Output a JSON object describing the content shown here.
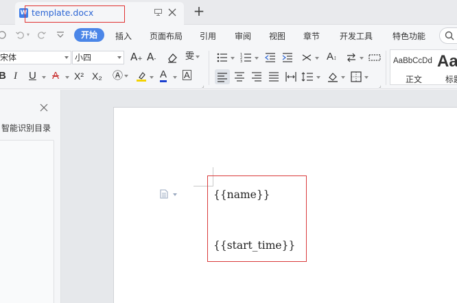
{
  "tab": {
    "title": "template.docx",
    "new_tab_symbol": "+"
  },
  "menu": {
    "items": [
      {
        "label": "开始",
        "active": true
      },
      {
        "label": "插入"
      },
      {
        "label": "页面布局"
      },
      {
        "label": "引用"
      },
      {
        "label": "审阅"
      },
      {
        "label": "视图"
      },
      {
        "label": "章节"
      },
      {
        "label": "开发工具"
      },
      {
        "label": "特色功能"
      }
    ]
  },
  "ribbon": {
    "font_name": "宋体",
    "font_size": "小四",
    "bold_label": "B",
    "italic_label": "I",
    "underline_label": "U",
    "strike_label": "A",
    "superscript_label": "X²",
    "subscript_label": "X₂",
    "font_color_label": "A",
    "styles": [
      {
        "sample": "AaBbCcDd",
        "label": "正文"
      },
      {
        "sample": "Aa",
        "label": "标题"
      }
    ]
  },
  "left_panel": {
    "title": "智能识别目录"
  },
  "document": {
    "fields": [
      "{{name}}",
      "{{start_time}}"
    ]
  },
  "colors": {
    "accent": "#4b86e8",
    "highlight_border": "#e0302f",
    "tab_text": "#2d66d4"
  }
}
